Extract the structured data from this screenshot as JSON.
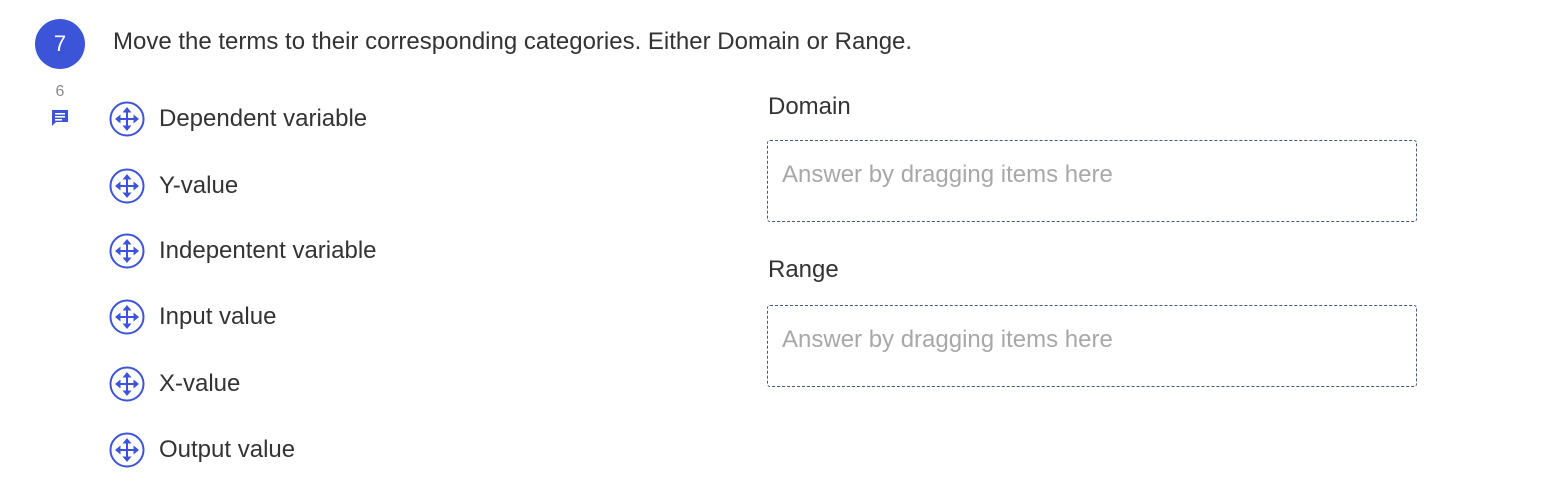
{
  "question": {
    "number": "7",
    "prompt": "Move the terms to their corresponding categories. Either Domain or Range.",
    "comment_count": "6",
    "comment_icon": "comment-icon"
  },
  "items": [
    {
      "label": "Dependent variable",
      "icon": "move-icon"
    },
    {
      "label": "Y-value",
      "icon": "move-icon"
    },
    {
      "label": "Indepentent variable",
      "icon": "move-icon"
    },
    {
      "label": "Input value",
      "icon": "move-icon"
    },
    {
      "label": "X-value",
      "icon": "move-icon"
    },
    {
      "label": "Output value",
      "icon": "move-icon"
    }
  ],
  "categories": [
    {
      "label": "Domain",
      "placeholder": "Answer by dragging items here"
    },
    {
      "label": "Range",
      "placeholder": "Answer by dragging items here"
    }
  ],
  "colors": {
    "accent": "#3b54d8",
    "text": "#333333",
    "placeholder": "#a8a8a8",
    "dropzone_border": "#4a5580"
  }
}
